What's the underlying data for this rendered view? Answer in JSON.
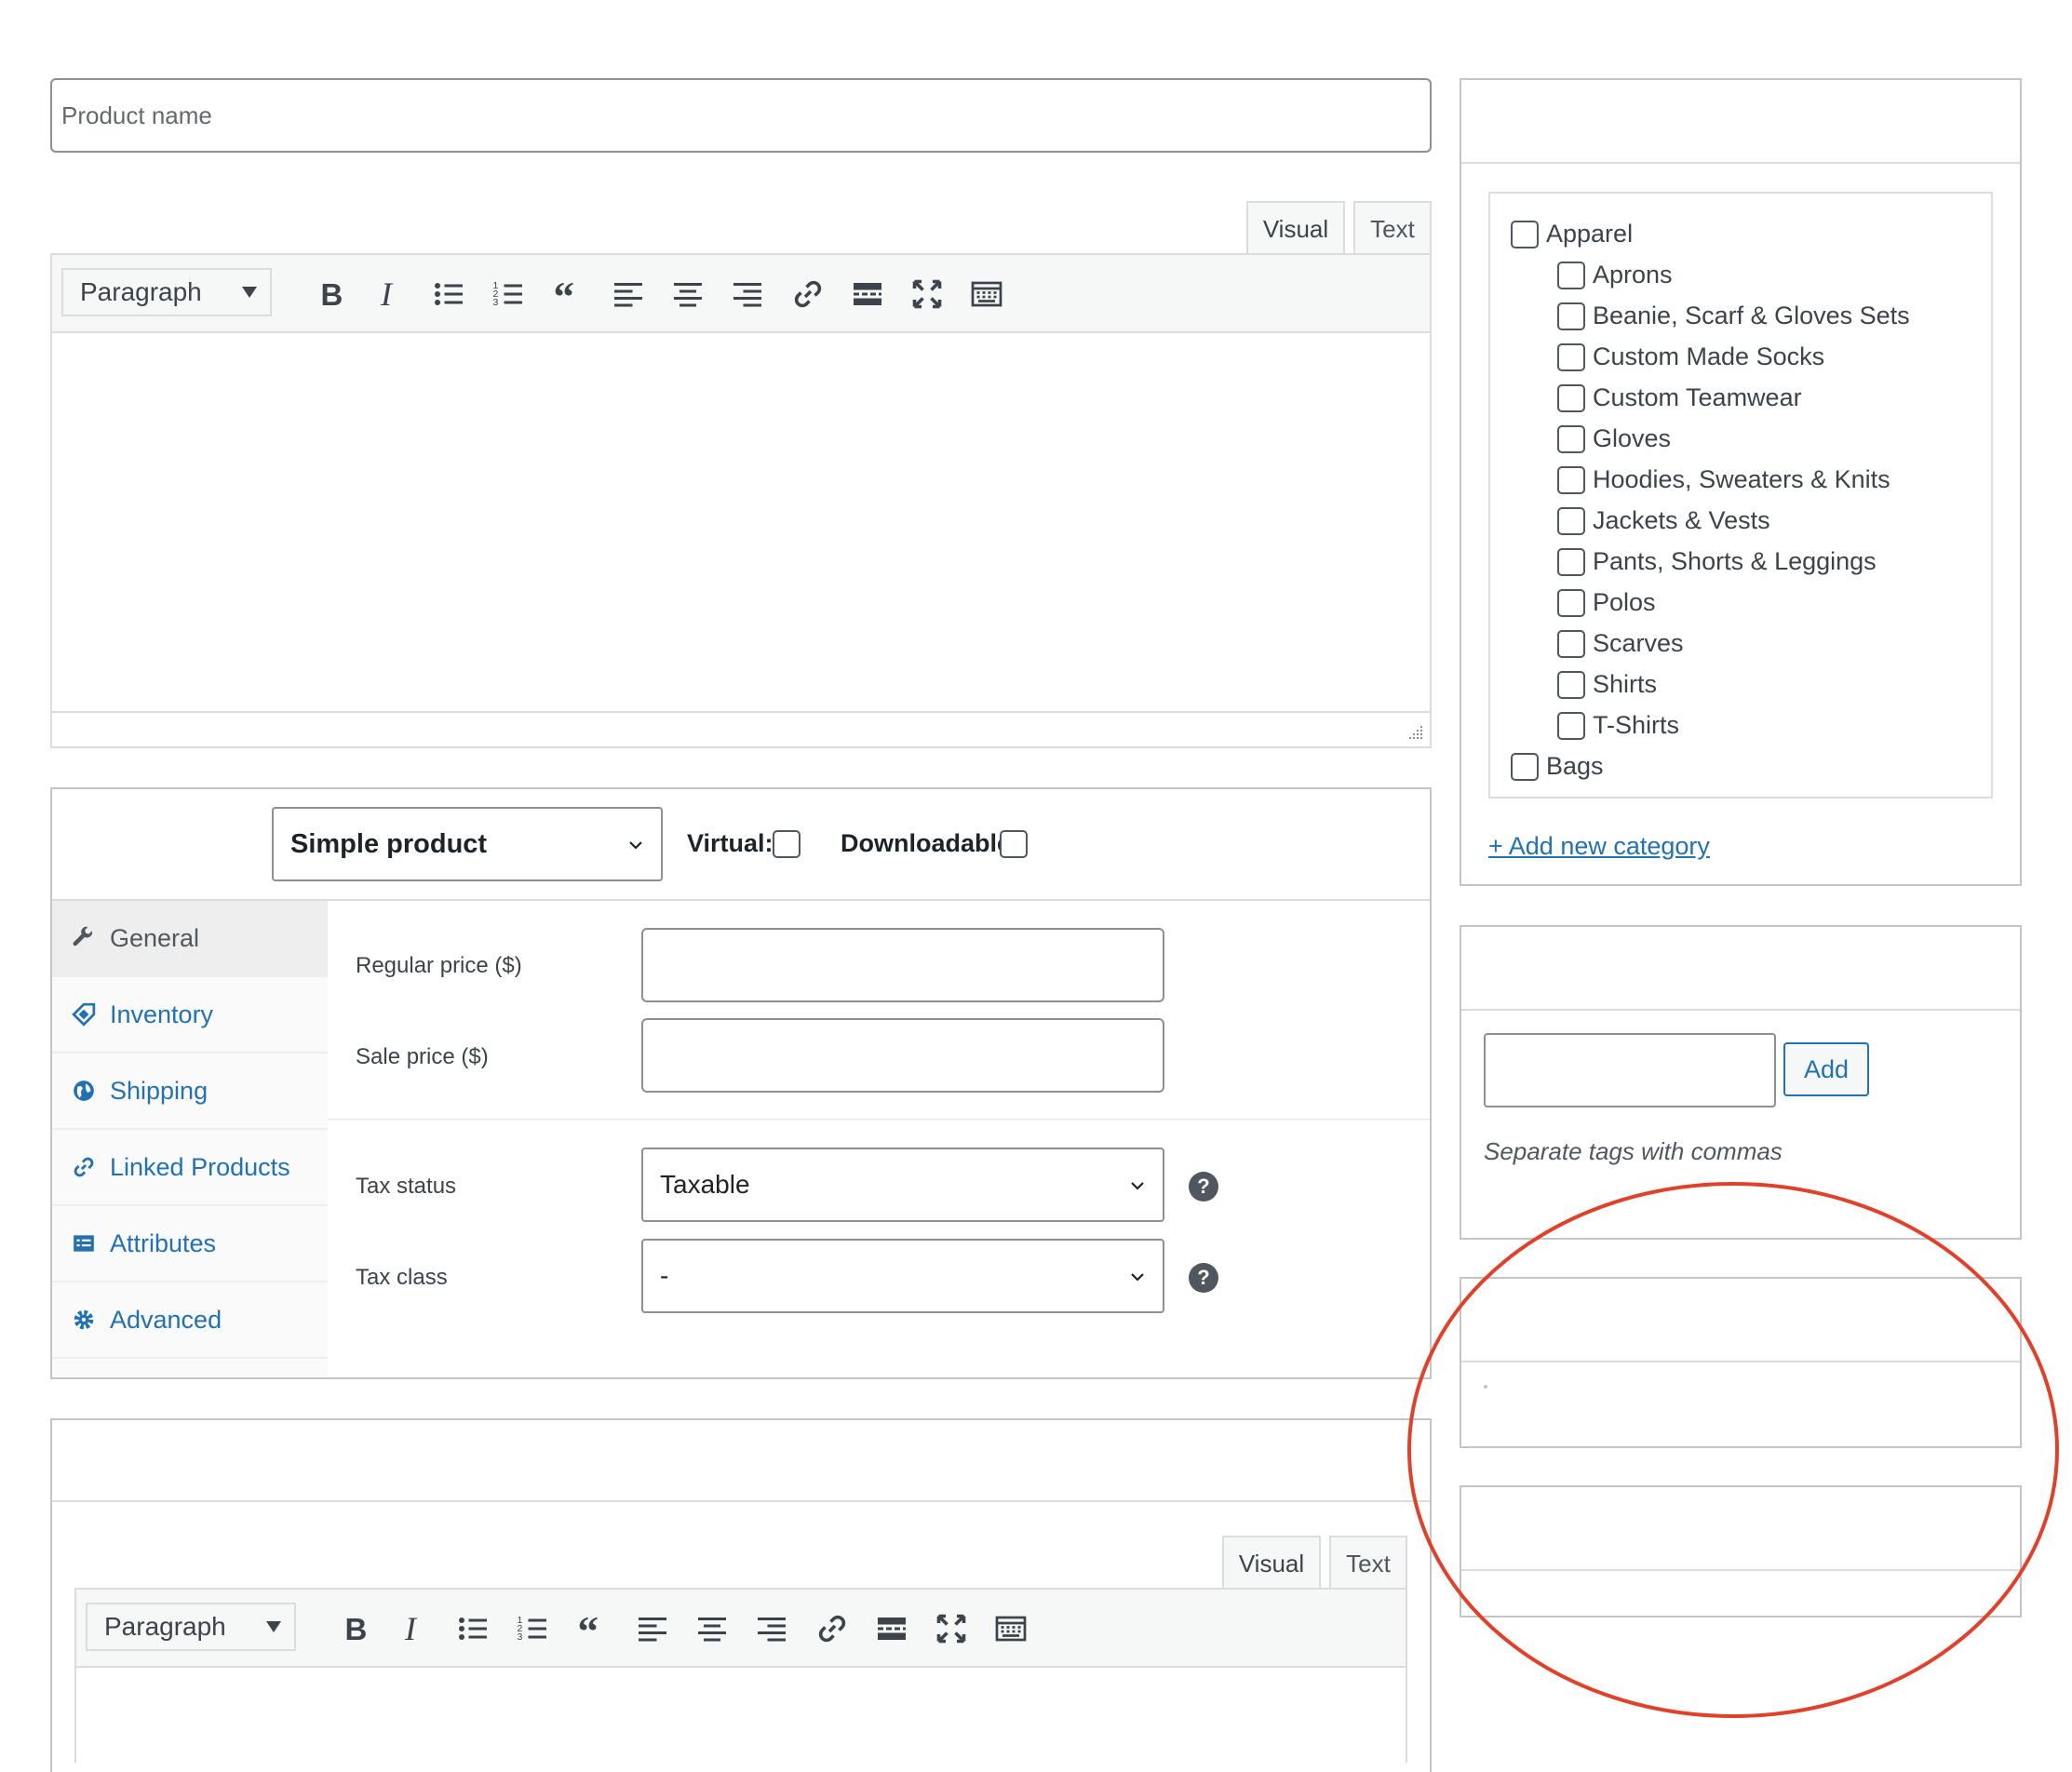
{
  "title_field": {
    "placeholder": "Product name"
  },
  "editor": {
    "tabs": [
      "Visual",
      "Text"
    ],
    "format_select": "Paragraph"
  },
  "product_data": {
    "type_select": "Simple product",
    "virtual_label": "Virtual:",
    "downloadable_label": "Downloadable:",
    "nav": [
      "General",
      "Inventory",
      "Shipping",
      "Linked Products",
      "Attributes",
      "Advanced"
    ],
    "fields": {
      "regular_price": "Regular price ($)",
      "sale_price": "Sale price ($)",
      "tax_status": "Tax status",
      "tax_status_value": "Taxable",
      "tax_class": "Tax class",
      "tax_class_value": "-",
      "help_glyph": "?"
    }
  },
  "short_description": {
    "tabs": [
      "Visual",
      "Text"
    ],
    "format_select": "Paragraph"
  },
  "categories": {
    "items": [
      {
        "label": "Apparel",
        "level": 0
      },
      {
        "label": "Aprons",
        "level": 1
      },
      {
        "label": "Beanie, Scarf & Gloves Sets",
        "level": 1
      },
      {
        "label": "Custom Made Socks",
        "level": 1
      },
      {
        "label": "Custom Teamwear",
        "level": 1
      },
      {
        "label": "Gloves",
        "level": 1
      },
      {
        "label": "Hoodies, Sweaters & Knits",
        "level": 1
      },
      {
        "label": "Jackets & Vests",
        "level": 1
      },
      {
        "label": "Pants, Shorts & Leggings",
        "level": 1
      },
      {
        "label": "Polos",
        "level": 1
      },
      {
        "label": "Scarves",
        "level": 1
      },
      {
        "label": "Shirts",
        "level": 1
      },
      {
        "label": "T-Shirts",
        "level": 1
      },
      {
        "label": "Bags",
        "level": 0
      }
    ],
    "add_new": "+ Add new category"
  },
  "tags": {
    "add_button": "Add",
    "hint": "Separate tags with commas"
  },
  "annotation": {
    "color": "#e0412b"
  },
  "colors": {
    "link": "#2271b1",
    "border": "#c3c4c7"
  }
}
